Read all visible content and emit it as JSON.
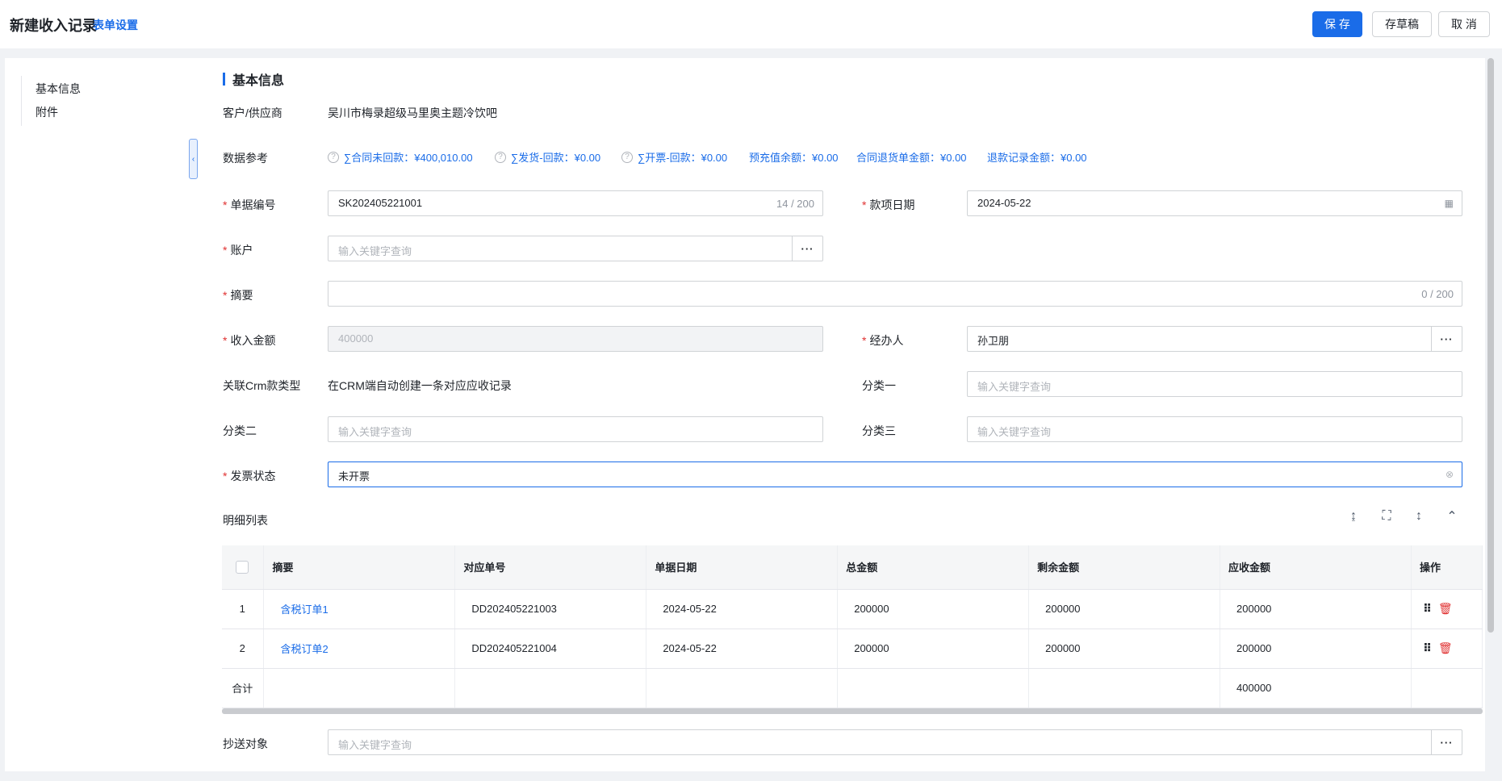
{
  "header": {
    "title": "新建收入记录",
    "form_settings": "表单设置",
    "save": "保 存",
    "draft": "存草稿",
    "cancel": "取 消"
  },
  "sidenav": {
    "items": [
      "基本信息",
      "附件"
    ],
    "collapse_icon": "chevron-left-icon"
  },
  "section": {
    "title": "基本信息"
  },
  "fields": {
    "customer": {
      "label": "客户/供应商",
      "value": "吴川市梅录超级马里奥主题冷饮吧"
    },
    "reference": {
      "label": "数据参考",
      "items": [
        "∑合同未回款：¥400,010.00",
        "∑发货-回款：¥0.00",
        "∑开票-回款：¥0.00",
        "预充值余额：¥0.00",
        "合同退货单金额：¥0.00",
        "退款记录金额：¥0.00"
      ]
    },
    "doc_no": {
      "label": "单据编号",
      "value": "SK202405221001",
      "count": "14 / 200"
    },
    "pay_date": {
      "label": "款项日期",
      "value": "2024-05-22"
    },
    "account": {
      "label": "账户",
      "placeholder": "输入关键字查询"
    },
    "summary": {
      "label": "摘要",
      "count": "0 / 200"
    },
    "amount": {
      "label": "收入金额",
      "value": "400000"
    },
    "handler": {
      "label": "经办人",
      "value": "孙卫朋"
    },
    "crm_type": {
      "label": "关联Crm款类型",
      "value": "在CRM端自动创建一条对应应收记录"
    },
    "cat1": {
      "label": "分类一",
      "placeholder": "输入关键字查询"
    },
    "cat2": {
      "label": "分类二",
      "placeholder": "输入关键字查询"
    },
    "cat3": {
      "label": "分类三",
      "placeholder": "输入关键字查询"
    },
    "invoice_status": {
      "label": "发票状态",
      "value": "未开票"
    },
    "cc": {
      "label": "抄送对象",
      "placeholder": "输入关键字查询"
    }
  },
  "detail": {
    "title": "明细列表",
    "columns": [
      "摘要",
      "对应单号",
      "单据日期",
      "总金额",
      "剩余金额",
      "应收金额",
      "操作"
    ],
    "rows": [
      {
        "idx": "1",
        "summary": "含税订单1",
        "order": "DD202405221003",
        "date": "2024-05-22",
        "total": "200000",
        "remain": "200000",
        "receivable": "200000"
      },
      {
        "idx": "2",
        "summary": "含税订单2",
        "order": "DD202405221004",
        "date": "2024-05-22",
        "total": "200000",
        "remain": "200000",
        "receivable": "200000"
      }
    ],
    "total_label": "合计",
    "total_receivable": "400000"
  }
}
